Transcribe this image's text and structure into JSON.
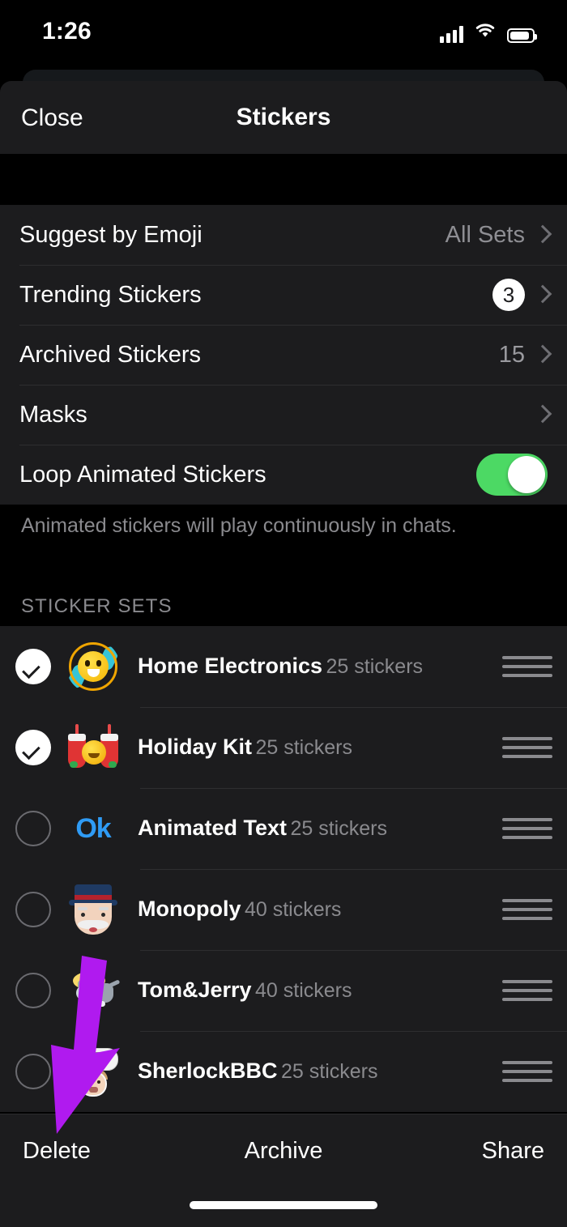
{
  "status_bar": {
    "time": "1:26",
    "signal_icon": "cellular-signal-icon",
    "wifi_icon": "wifi-icon",
    "battery_icon": "battery-icon"
  },
  "nav": {
    "close_label": "Close",
    "title": "Stickers"
  },
  "settings": {
    "rows": [
      {
        "label": "Suggest by Emoji",
        "value": "All Sets",
        "kind": "value"
      },
      {
        "label": "Trending Stickers",
        "value": "3",
        "kind": "badge"
      },
      {
        "label": "Archived Stickers",
        "value": "15",
        "kind": "count"
      },
      {
        "label": "Masks",
        "value": "",
        "kind": "plain"
      },
      {
        "label": "Loop Animated Stickers",
        "value": "on",
        "kind": "toggle"
      }
    ],
    "footer_note": "Animated stickers will play continuously in chats."
  },
  "sticker_sets": {
    "header": "STICKER SETS",
    "items": [
      {
        "name": "Home Electronics",
        "count": "25 stickers",
        "selected": true,
        "thumb": "fan-sticker-thumbnail"
      },
      {
        "name": "Holiday Kit",
        "count": "25 stickers",
        "selected": true,
        "thumb": "holiday-stocking-sticker-thumbnail"
      },
      {
        "name": "Animated Text",
        "count": "25 stickers",
        "selected": false,
        "thumb": "ok-text-sticker-thumbnail"
      },
      {
        "name": "Monopoly",
        "count": "40 stickers",
        "selected": false,
        "thumb": "monopoly-man-sticker-thumbnail"
      },
      {
        "name": "Tom&Jerry",
        "count": "40 stickers",
        "selected": false,
        "thumb": "tom-and-jerry-sticker-thumbnail"
      },
      {
        "name": "SherlockBBC",
        "count": "25 stickers",
        "selected": false,
        "thumb": "sherlock-sticker-thumbnail"
      }
    ]
  },
  "toolbar": {
    "delete_label": "Delete",
    "archive_label": "Archive",
    "share_label": "Share"
  },
  "annotation": {
    "arrow_color": "#b01aef",
    "points_to": "Delete"
  },
  "colors": {
    "background": "#000000",
    "surface": "#1c1c1e",
    "separator": "#2e2e30",
    "primary_text": "#ffffff",
    "secondary_text": "#8a8a8e",
    "toggle_on": "#4cd964",
    "accent_annotation": "#b01aef",
    "ok_sticker_blue": "#2f9bf5"
  }
}
